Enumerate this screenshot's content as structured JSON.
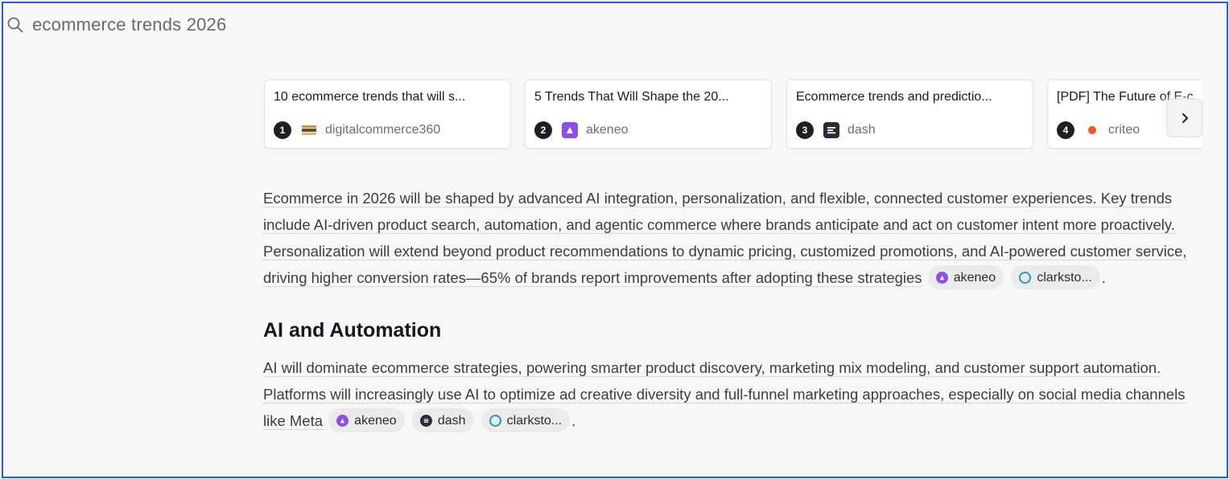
{
  "search": {
    "query": "ecommerce trends 2026"
  },
  "sources": [
    {
      "num": "1",
      "title": "10 ecommerce trends that will s...",
      "source": "digitalcommerce360"
    },
    {
      "num": "2",
      "title": "5 Trends That Will Shape the 20...",
      "source": "akeneo"
    },
    {
      "num": "3",
      "title": "Ecommerce trends and predictio...",
      "source": "dash"
    },
    {
      "num": "4",
      "title": "[PDF] The Future of E-c",
      "source": "criteo"
    }
  ],
  "answer": {
    "intro": {
      "text": "Ecommerce in 2026 will be shaped by advanced AI integration, personalization, and flexible, connected customer experiences. Key trends include AI-driven product search, automation, and agentic commerce where brands anticipate and act on customer intent more proactively. Personalization will extend beyond product recommendations to dynamic pricing, customized promotions, and AI-powered customer service, driving higher conversion rates—65% of brands report improvements after adopting these strategies",
      "citations": [
        "akeneo",
        "clarksto..."
      ],
      "end": "."
    },
    "section1": {
      "heading": "AI and Automation",
      "text": "AI will dominate ecommerce strategies, powering smarter product discovery, marketing mix modeling, and customer support automation. Platforms will increasingly use AI to optimize ad creative diversity and full-funnel marketing approaches, especially on social media channels like Meta",
      "citations": [
        "akeneo",
        "dash",
        "clarksto..."
      ],
      "end": "."
    }
  },
  "colors": {
    "frame_border": "#1d63c9",
    "akeneo": "#8e4ee6",
    "dash": "#2b2a3a",
    "criteo": "#f0561d",
    "clarkston": "#2a9bb4"
  }
}
